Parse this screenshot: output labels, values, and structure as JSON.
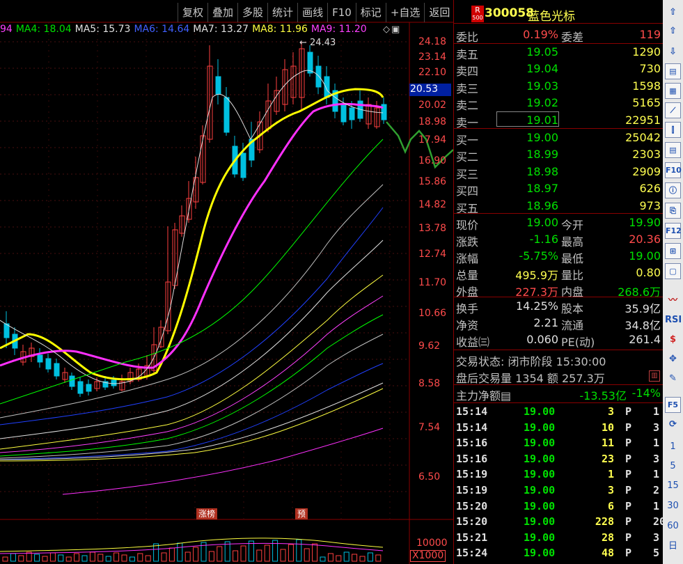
{
  "toolbar": [
    "复权",
    "叠加",
    "多股",
    "统计",
    "画线",
    "F10",
    "标记",
    "+自选",
    "返回"
  ],
  "ma_legend": [
    {
      "text": "94",
      "color": "#ff40ff"
    },
    {
      "text": "MA4: 18.04",
      "color": "#00e000"
    },
    {
      "text": "MA5: 15.73",
      "color": "#e0e0e0"
    },
    {
      "text": "MA6: 14.64",
      "color": "#4060ff"
    },
    {
      "text": "MA7: 13.27",
      "color": "#e0e0e0"
    },
    {
      "text": "MA8: 11.96",
      "color": "#ffff40"
    },
    {
      "text": "MA9: 11.20",
      "color": "#ff40ff"
    }
  ],
  "ma_icons": [
    "◇",
    "▣"
  ],
  "high_label": "24.43",
  "current_price_tag": "20.53",
  "price_ticks": [
    "24.18",
    "23.14",
    "22.10",
    "20.02",
    "18.98",
    "17.94",
    "16.90",
    "15.86",
    "14.82",
    "13.78",
    "12.74",
    "11.70",
    "10.66",
    "9.62",
    "8.58",
    "7.54",
    "6.50"
  ],
  "event_tags": [
    "涨榜",
    "预"
  ],
  "volume": {
    "label": "10000",
    "unit": "X1000"
  },
  "stock": {
    "badge_top": "R",
    "badge_bottom": "500",
    "code": "300058",
    "name": "蓝色光标"
  },
  "ratio": {
    "label": "委比",
    "value": "0.19%",
    "label2": "委差",
    "value2": "119"
  },
  "asks": [
    {
      "label": "卖五",
      "price": "19.05",
      "vol": "1290"
    },
    {
      "label": "卖四",
      "price": "19.04",
      "vol": "730"
    },
    {
      "label": "卖三",
      "price": "19.03",
      "vol": "1598"
    },
    {
      "label": "卖二",
      "price": "19.02",
      "vol": "5165"
    },
    {
      "label": "卖一",
      "price": "19.01",
      "vol": "22951"
    }
  ],
  "bids": [
    {
      "label": "买一",
      "price": "19.00",
      "vol": "25042"
    },
    {
      "label": "买二",
      "price": "18.99",
      "vol": "2303"
    },
    {
      "label": "买三",
      "price": "18.98",
      "vol": "2909"
    },
    {
      "label": "买四",
      "price": "18.97",
      "vol": "626"
    },
    {
      "label": "买五",
      "price": "18.96",
      "vol": "973"
    }
  ],
  "stats": [
    {
      "l": "现价",
      "v": "19.00",
      "vc": "g",
      "l2": "今开",
      "v2": "19.90",
      "v2c": "g"
    },
    {
      "l": "涨跌",
      "v": "-1.16",
      "vc": "g",
      "l2": "最高",
      "v2": "20.36",
      "v2c": "r"
    },
    {
      "l": "涨幅",
      "v": "-5.75%",
      "vc": "g",
      "l2": "最低",
      "v2": "19.00",
      "v2c": "g"
    },
    {
      "l": "总量",
      "v": "495.9万",
      "vc": "y",
      "l2": "量比",
      "v2": "0.80",
      "v2c": "y"
    },
    {
      "l": "外盘",
      "v": "227.3万",
      "vc": "r",
      "l2": "内盘",
      "v2": "268.6万",
      "v2c": "g"
    }
  ],
  "stats2": [
    {
      "l": "换手",
      "v": "14.25%",
      "vc": "w",
      "l2": "股本",
      "v2": "35.9亿",
      "v2c": "w"
    },
    {
      "l": "净资",
      "v": "2.21",
      "vc": "w",
      "l2": "流通",
      "v2": "34.8亿",
      "v2c": "w"
    },
    {
      "l": "收益㈢",
      "v": "0.060",
      "vc": "w",
      "l2": "PE(动)",
      "v2": "261.4",
      "v2c": "w"
    }
  ],
  "trade_status": "交易状态: 闭市阶段 15:30:00",
  "after_hours": "盘后交易量 1354 额 257.3万",
  "main_flow": {
    "label": "主力净额▤",
    "value": "-13.53亿",
    "pct": "-14%"
  },
  "ticks": [
    {
      "t": "15:14",
      "p": "19.00",
      "q": "3",
      "f": "P",
      "n": "1"
    },
    {
      "t": "15:14",
      "p": "19.00",
      "q": "10",
      "f": "P",
      "n": "3"
    },
    {
      "t": "15:16",
      "p": "19.00",
      "q": "11",
      "f": "P",
      "n": "1"
    },
    {
      "t": "15:16",
      "p": "19.00",
      "q": "23",
      "f": "P",
      "n": "3"
    },
    {
      "t": "15:19",
      "p": "19.00",
      "q": "1",
      "f": "P",
      "n": "1"
    },
    {
      "t": "15:19",
      "p": "19.00",
      "q": "3",
      "f": "P",
      "n": "2"
    },
    {
      "t": "15:20",
      "p": "19.00",
      "q": "6",
      "f": "P",
      "n": "1"
    },
    {
      "t": "15:20",
      "p": "19.00",
      "q": "228",
      "f": "P",
      "n": "20"
    },
    {
      "t": "15:21",
      "p": "19.00",
      "q": "28",
      "f": "P",
      "n": "3"
    },
    {
      "t": "15:24",
      "p": "19.00",
      "q": "48",
      "f": "P",
      "n": "5"
    }
  ],
  "sidebar": [
    "⇧",
    "⇧",
    "⇩",
    "",
    "",
    "",
    "",
    "",
    "F10",
    "",
    "",
    "F12",
    "",
    "",
    "",
    "RSI",
    "$",
    "✥",
    "✎",
    "F5",
    "",
    "1",
    "5",
    "15",
    "30",
    "60",
    "日"
  ]
}
